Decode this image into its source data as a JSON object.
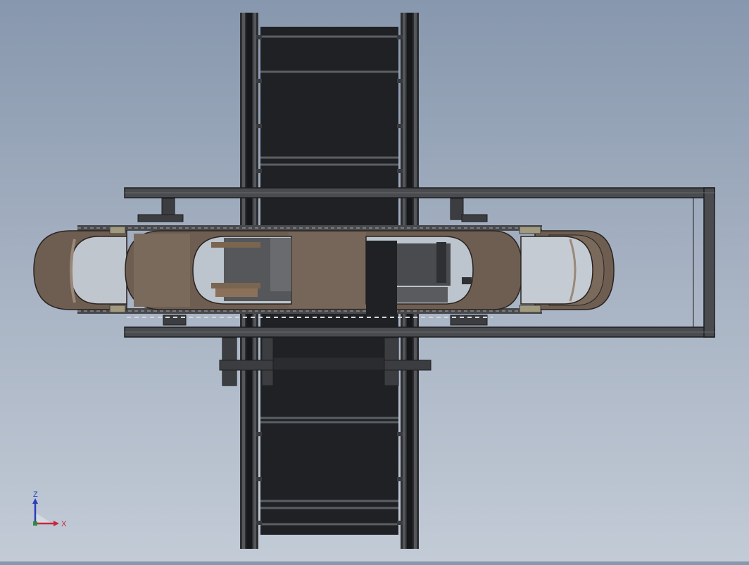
{
  "view": {
    "background_top": "#8797ad",
    "background_bottom": "#c2cbd6",
    "model_colors": {
      "belt": "#1f2124",
      "belt_seam": "#5b5f64",
      "rail": "#2d2e31",
      "frame": "#4a4b4e",
      "roller_shell": "#6e5e51",
      "roller_light": "#9a8878",
      "roller_dark": "#4c4036",
      "bracket": "#3c3d40"
    }
  },
  "triad": {
    "z_label": "Z",
    "x_label": "X",
    "z_color": "#2a3dbd",
    "x_color": "#c8283a",
    "y_color": "#2e8b3e",
    "icons": [
      "axis-triad-icon"
    ]
  }
}
